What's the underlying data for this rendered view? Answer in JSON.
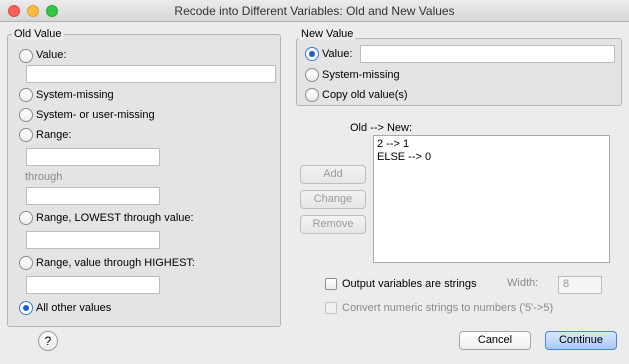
{
  "window": {
    "title": "Recode into Different Variables: Old and New Values"
  },
  "old_value": {
    "group_title": "Old Value",
    "value_label": "Value:",
    "value_input": "",
    "system_missing_label": "System-missing",
    "system_or_user_missing_label": "System- or user-missing",
    "range_label": "Range:",
    "range_from_input": "",
    "through_label": "through",
    "range_to_input": "",
    "range_lowest_label": "Range, LOWEST through value:",
    "range_lowest_input": "",
    "range_highest_label": "Range, value through HIGHEST:",
    "range_highest_input": "",
    "all_other_label": "All other values",
    "selected": "all_other"
  },
  "new_value": {
    "group_title": "New Value",
    "value_label": "Value:",
    "value_input": "",
    "system_missing_label": "System-missing",
    "copy_old_label": "Copy old value(s)",
    "selected": "value"
  },
  "mapping": {
    "label": "Old --> New:",
    "items": [
      "2 --> 1",
      "ELSE --> 0"
    ]
  },
  "buttons": {
    "add": "Add",
    "change": "Change",
    "remove": "Remove",
    "cancel": "Cancel",
    "continue": "Continue",
    "help": "?"
  },
  "options": {
    "output_strings_label": "Output variables are strings",
    "width_label": "Width:",
    "width_value": "8",
    "convert_label": "Convert numeric strings to numbers ('5'->5)"
  }
}
